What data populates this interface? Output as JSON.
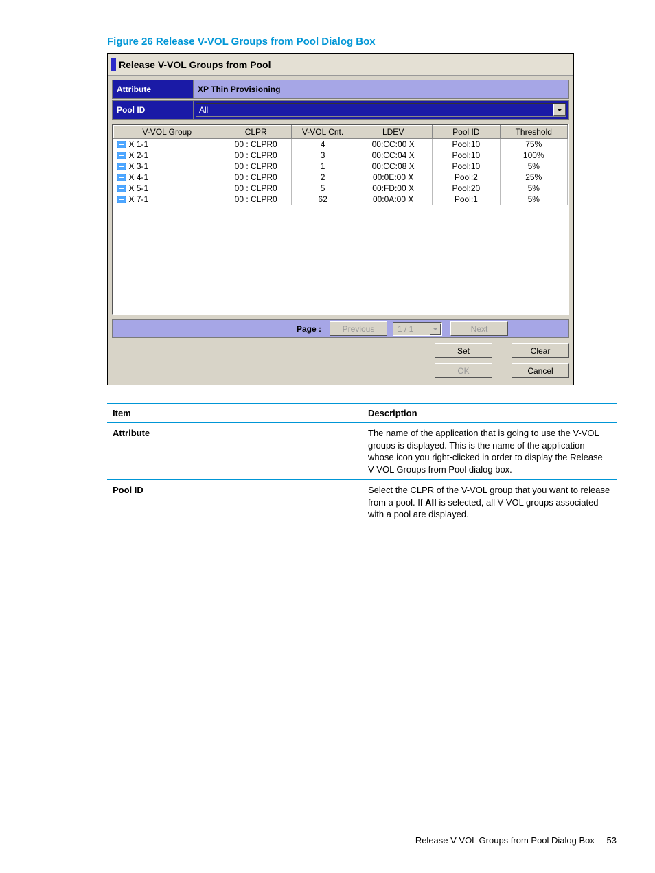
{
  "caption": "Figure 26 Release V-VOL Groups from Pool Dialog Box",
  "dialog": {
    "title": "Release V-VOL Groups from Pool",
    "attribute_label": "Attribute",
    "attribute_value": "XP Thin Provisioning",
    "pool_id_label": "Pool ID",
    "pool_id_value": "All"
  },
  "grid": {
    "headers": [
      "V-VOL Group",
      "CLPR",
      "V-VOL Cnt.",
      "LDEV",
      "Pool ID",
      "Threshold"
    ],
    "rows": [
      {
        "group": "X 1-1",
        "clpr": "00 : CLPR0",
        "cnt": "4",
        "ldev": "00:CC:00 X",
        "pool": "Pool:10",
        "th": "75%"
      },
      {
        "group": "X 2-1",
        "clpr": "00 : CLPR0",
        "cnt": "3",
        "ldev": "00:CC:04 X",
        "pool": "Pool:10",
        "th": "100%"
      },
      {
        "group": "X 3-1",
        "clpr": "00 : CLPR0",
        "cnt": "1",
        "ldev": "00:CC:08 X",
        "pool": "Pool:10",
        "th": "5%"
      },
      {
        "group": "X 4-1",
        "clpr": "00 : CLPR0",
        "cnt": "2",
        "ldev": "00:0E:00 X",
        "pool": "Pool:2",
        "th": "25%"
      },
      {
        "group": "X 5-1",
        "clpr": "00 : CLPR0",
        "cnt": "5",
        "ldev": "00:FD:00 X",
        "pool": "Pool:20",
        "th": "5%"
      },
      {
        "group": "X 7-1",
        "clpr": "00 : CLPR0",
        "cnt": "62",
        "ldev": "00:0A:00 X",
        "pool": "Pool:1",
        "th": "5%"
      }
    ]
  },
  "pager": {
    "label": "Page :",
    "previous": "Previous",
    "current": "1 / 1",
    "next": "Next"
  },
  "buttons": {
    "set": "Set",
    "clear": "Clear",
    "ok": "OK",
    "cancel": "Cancel"
  },
  "desc_headers": {
    "item": "Item",
    "desc": "Description"
  },
  "desc_rows": [
    {
      "item": "Attribute",
      "desc": "The name of the application that is going to use the V-VOL groups is displayed. This is the name of the application whose icon you right-clicked in order to display the Release V-VOL Groups from Pool dialog box."
    },
    {
      "item": "Pool ID",
      "desc_pre": "Select the CLPR of the V-VOL group that you want to release from a pool. If ",
      "desc_strong": "All",
      "desc_post": " is selected, all V-VOL groups associated with a pool are displayed."
    }
  ],
  "footer": {
    "title": "Release V-VOL Groups from Pool Dialog Box",
    "page": "53"
  }
}
